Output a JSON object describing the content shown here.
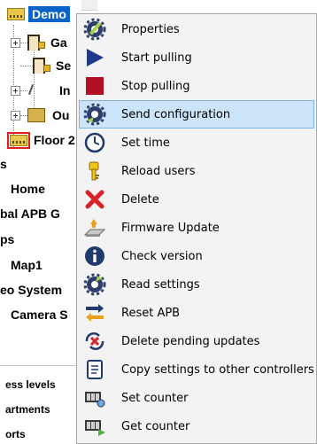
{
  "tree": {
    "top_nodes": [
      {
        "label": "Demo",
        "icon": "map-icon",
        "selected": true
      },
      {
        "label": "Ga",
        "icon": "door-icon"
      },
      {
        "label": "Se",
        "icon": "door-icon"
      },
      {
        "label": "In",
        "icon": "input-icon"
      },
      {
        "label": "Ou",
        "icon": "output-icon"
      },
      {
        "label": "Floor 2",
        "icon": "map-icon"
      }
    ],
    "sections": [
      "s",
      "Home",
      "bal APB G",
      "ps",
      "Map1",
      "eo System",
      "Camera S"
    ],
    "bottom_items": [
      "ess levels",
      "artments",
      "orts"
    ]
  },
  "colors": {
    "selection": "#0a64c8",
    "menu_highlight": "#cce4f7",
    "menu_highlight_border": "#7eb4ea",
    "menu_background": "#f3f3f3",
    "floor_icon_border": "#e02020"
  },
  "menu": {
    "items": [
      {
        "label": "Properties",
        "icon": "gear-wrench-icon"
      },
      {
        "label": "Start pulling",
        "icon": "play-triangle-icon"
      },
      {
        "label": "Stop pulling",
        "icon": "stop-square-icon"
      },
      {
        "label": "Send configuration",
        "icon": "gear-send-icon",
        "highlighted": true
      },
      {
        "label": "Set time",
        "icon": "clock-icon"
      },
      {
        "label": "Reload users",
        "icon": "key-icon"
      },
      {
        "label": "Delete",
        "icon": "red-x-icon"
      },
      {
        "label": "Firmware Update",
        "icon": "firmware-update-icon"
      },
      {
        "label": "Check version",
        "icon": "info-icon"
      },
      {
        "label": "Read settings",
        "icon": "gear-read-icon"
      },
      {
        "label": "Reset APB",
        "icon": "reset-arrows-icon"
      },
      {
        "label": "Delete pending updates",
        "icon": "delete-updates-icon"
      },
      {
        "label": "Copy settings to other controllers",
        "icon": "copy-document-icon"
      },
      {
        "label": "Set counter",
        "icon": "set-counter-icon"
      },
      {
        "label": "Get counter",
        "icon": "get-counter-icon"
      }
    ]
  }
}
